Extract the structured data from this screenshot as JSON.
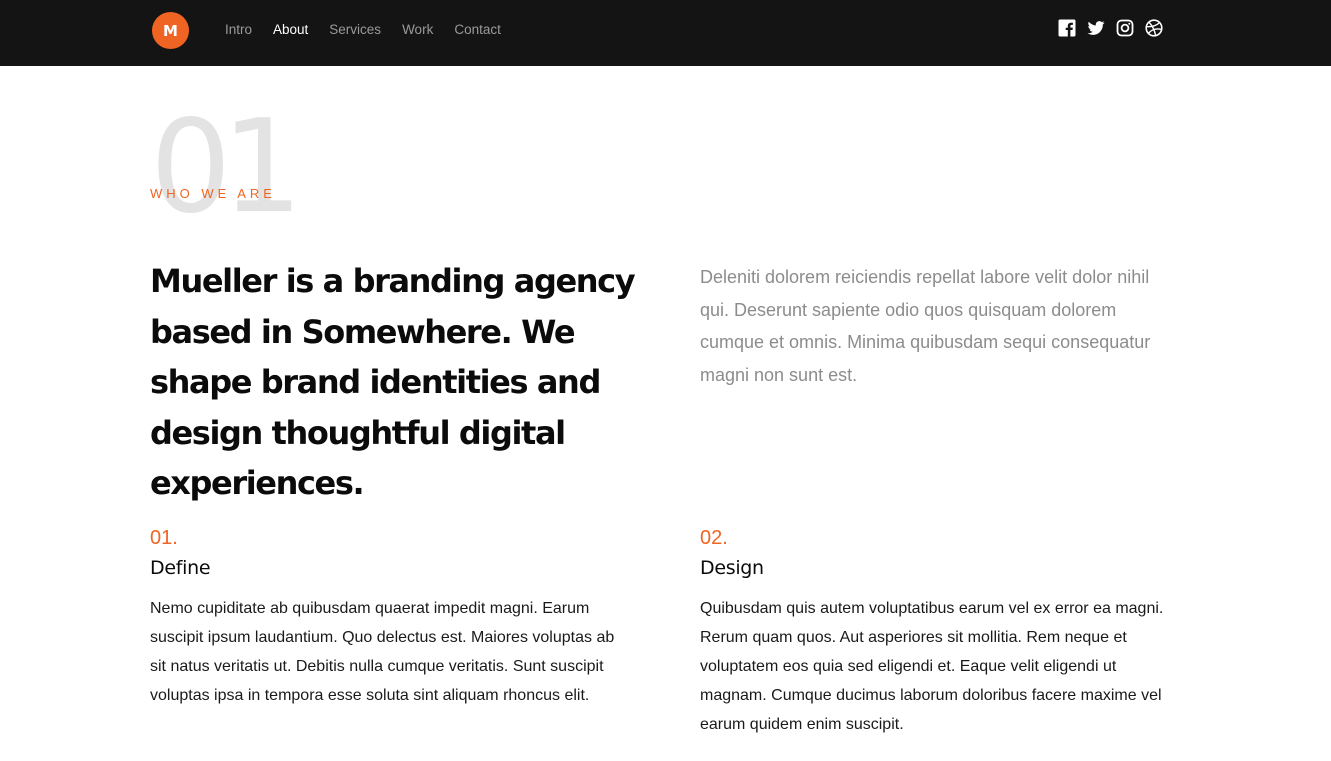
{
  "header": {
    "logo_letter": "M",
    "nav": [
      {
        "label": "Intro",
        "active": false
      },
      {
        "label": "About",
        "active": true
      },
      {
        "label": "Services",
        "active": false
      },
      {
        "label": "Work",
        "active": false
      },
      {
        "label": "Contact",
        "active": false
      }
    ],
    "social_icons": [
      "facebook-icon",
      "twitter-icon",
      "instagram-icon",
      "dribbble-icon"
    ]
  },
  "colors": {
    "accent": "#f06423",
    "header_bg": "#141414",
    "big_number": "#e3e3e3",
    "muted_text": "#8c8c8c"
  },
  "about": {
    "big_number": "01",
    "eyebrow": "WHO WE ARE",
    "lead": "Mueller is a branding agency based in Somewhere. We shape brand identities and design thoughtful digital experiences.",
    "side_text": "Deleniti dolorem reiciendis repellat labore velit dolor nihil qui. Deserunt sapiente odio quos quisquam dolorem cumque et omnis. Minima quibusdam sequi consequatur magni non sunt est."
  },
  "features": [
    {
      "number": "01.",
      "title": "Define",
      "body": "Nemo cupiditate ab quibusdam quaerat impedit magni. Earum suscipit ipsum laudantium. Quo delectus est. Maiores voluptas ab sit natus veritatis ut. Debitis nulla cumque veritatis. Sunt suscipit voluptas ipsa in tempora esse soluta sint aliquam rhoncus elit."
    },
    {
      "number": "02.",
      "title": "Design",
      "body": "Quibusdam quis autem voluptatibus earum vel ex error ea magni. Rerum quam quos. Aut asperiores sit mollitia. Rem neque et voluptatem eos quia sed eligendi et. Eaque velit eligendi ut magnam. Cumque ducimus laborum doloribus facere maxime vel earum quidem enim suscipit."
    }
  ]
}
